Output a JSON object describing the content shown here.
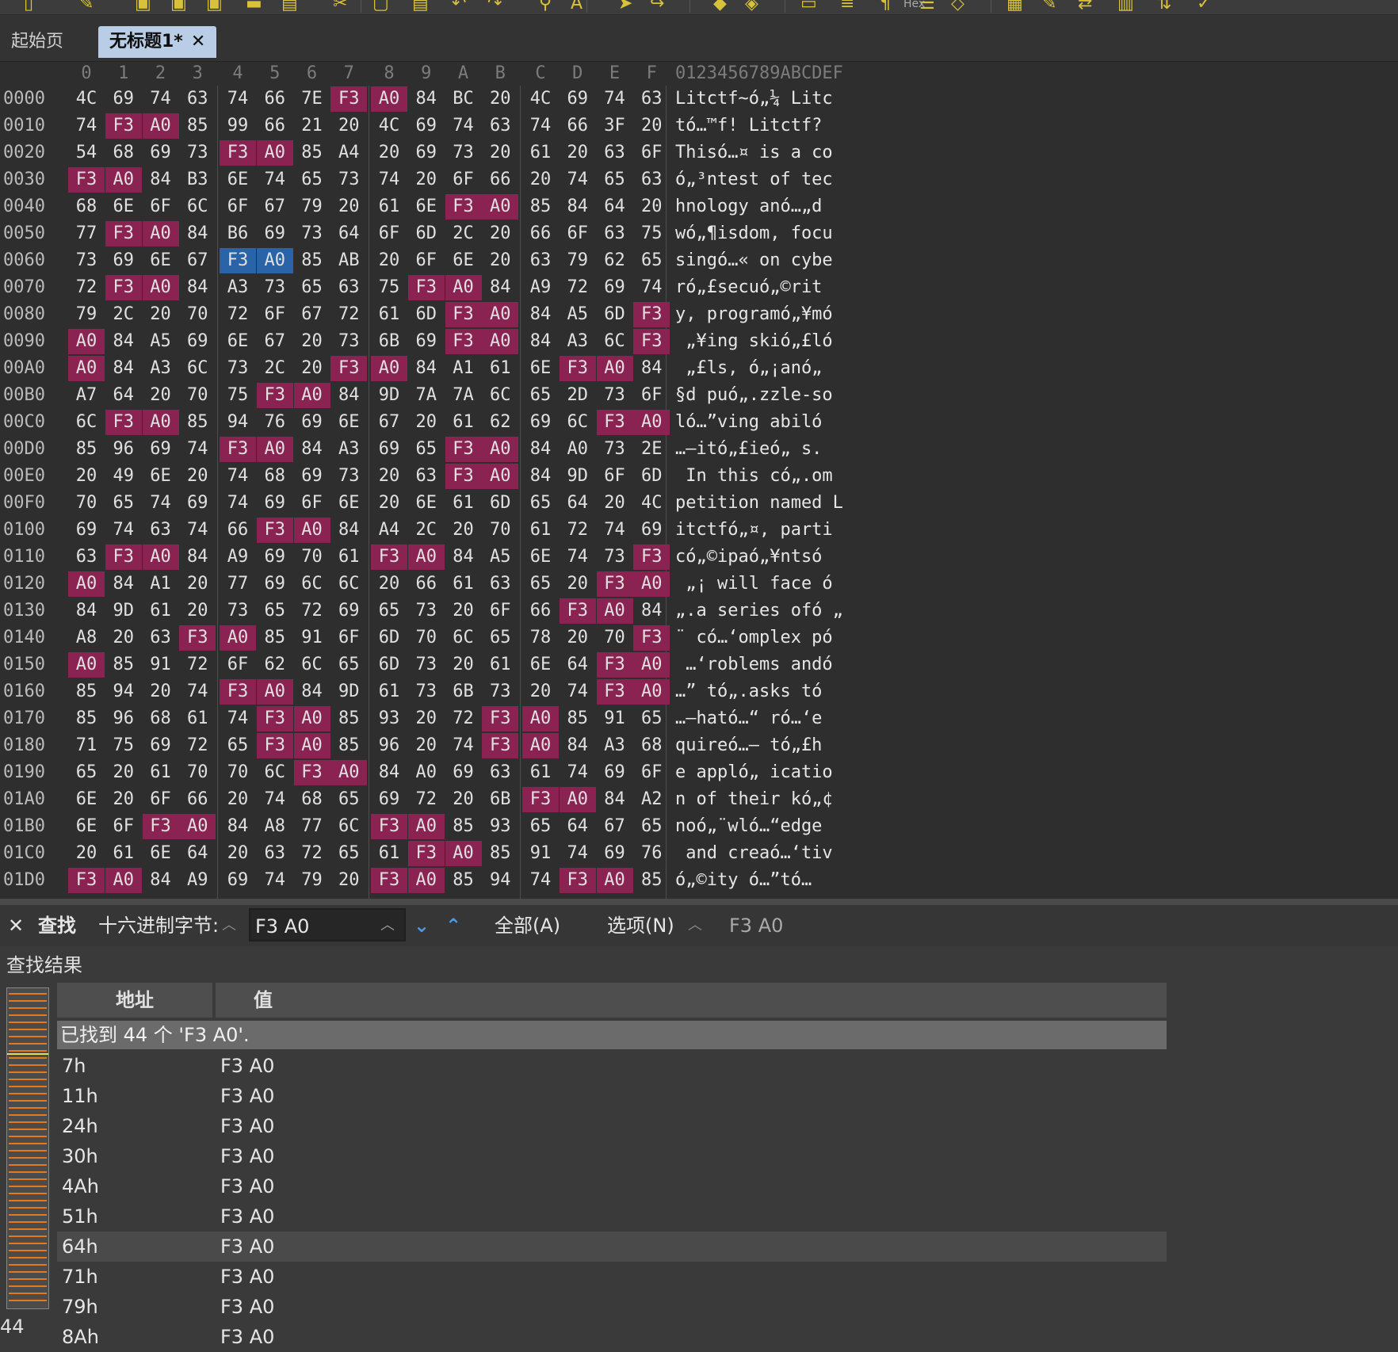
{
  "toolbar": {
    "icons": [
      "new-file",
      "open-folder",
      "save",
      "save-as",
      "save-all",
      "folder",
      "copy-files",
      "cut",
      "copy",
      "paste",
      "undo",
      "redo",
      "find",
      "replace-text",
      "find-next",
      "go-to",
      "bookmark",
      "compare",
      "hex-mode",
      "word-wrap",
      "pilcrow",
      "columns",
      "erase",
      "table",
      "edit",
      "transfer",
      "chart",
      "sort",
      "checklist"
    ],
    "hex_badge": "Hex"
  },
  "tabs": [
    {
      "label": "起始页",
      "active": false
    },
    {
      "label": "无标题1*",
      "active": true,
      "close": "✕"
    }
  ],
  "hex_view": {
    "column_headers": [
      "0",
      "1",
      "2",
      "3",
      "4",
      "5",
      "6",
      "7",
      "8",
      "9",
      "A",
      "B",
      "C",
      "D",
      "E",
      "F"
    ],
    "ascii_header": "0123456789ABCDEF",
    "rows": [
      {
        "addr": "0000",
        "bytes": [
          "4C",
          "69",
          "74",
          "63",
          "74",
          "66",
          "7E",
          "F3",
          "A0",
          "84",
          "BC",
          "20",
          "4C",
          "69",
          "74",
          "63"
        ],
        "ascii": "Litctf~ó„¼ Litc"
      },
      {
        "addr": "0010",
        "bytes": [
          "74",
          "F3",
          "A0",
          "85",
          "99",
          "66",
          "21",
          "20",
          "4C",
          "69",
          "74",
          "63",
          "74",
          "66",
          "3F",
          "20"
        ],
        "ascii": "tó…™f! Litctf? "
      },
      {
        "addr": "0020",
        "bytes": [
          "54",
          "68",
          "69",
          "73",
          "F3",
          "A0",
          "85",
          "A4",
          "20",
          "69",
          "73",
          "20",
          "61",
          "20",
          "63",
          "6F"
        ],
        "ascii": "Thisó…¤ is a co"
      },
      {
        "addr": "0030",
        "bytes": [
          "F3",
          "A0",
          "84",
          "B3",
          "6E",
          "74",
          "65",
          "73",
          "74",
          "20",
          "6F",
          "66",
          "20",
          "74",
          "65",
          "63"
        ],
        "ascii": "ó„³ntest of tec"
      },
      {
        "addr": "0040",
        "bytes": [
          "68",
          "6E",
          "6F",
          "6C",
          "6F",
          "67",
          "79",
          "20",
          "61",
          "6E",
          "F3",
          "A0",
          "85",
          "84",
          "64",
          "20"
        ],
        "ascii": "hnology anó…„d "
      },
      {
        "addr": "0050",
        "bytes": [
          "77",
          "F3",
          "A0",
          "84",
          "B6",
          "69",
          "73",
          "64",
          "6F",
          "6D",
          "2C",
          "20",
          "66",
          "6F",
          "63",
          "75"
        ],
        "ascii": "wó„¶isdom, focu"
      },
      {
        "addr": "0060",
        "bytes": [
          "73",
          "69",
          "6E",
          "67",
          "F3",
          "A0",
          "85",
          "AB",
          "20",
          "6F",
          "6E",
          "20",
          "63",
          "79",
          "62",
          "65"
        ],
        "ascii": "singó…« on cybe"
      },
      {
        "addr": "0070",
        "bytes": [
          "72",
          "F3",
          "A0",
          "84",
          "A3",
          "73",
          "65",
          "63",
          "75",
          "F3",
          "A0",
          "84",
          "A9",
          "72",
          "69",
          "74"
        ],
        "ascii": "ró„£secuó„©rit"
      },
      {
        "addr": "0080",
        "bytes": [
          "79",
          "2C",
          "20",
          "70",
          "72",
          "6F",
          "67",
          "72",
          "61",
          "6D",
          "F3",
          "A0",
          "84",
          "A5",
          "6D",
          "F3"
        ],
        "ascii": "y, programó„¥mó"
      },
      {
        "addr": "0090",
        "bytes": [
          "A0",
          "84",
          "A5",
          "69",
          "6E",
          "67",
          "20",
          "73",
          "6B",
          "69",
          "F3",
          "A0",
          "84",
          "A3",
          "6C",
          "F3"
        ],
        "ascii": " „¥ing skió„£ló"
      },
      {
        "addr": "00A0",
        "bytes": [
          "A0",
          "84",
          "A3",
          "6C",
          "73",
          "2C",
          "20",
          "F3",
          "A0",
          "84",
          "A1",
          "61",
          "6E",
          "F3",
          "A0",
          "84"
        ],
        "ascii": " „£ls, ó„¡anó„"
      },
      {
        "addr": "00B0",
        "bytes": [
          "A7",
          "64",
          "20",
          "70",
          "75",
          "F3",
          "A0",
          "84",
          "9D",
          "7A",
          "7A",
          "6C",
          "65",
          "2D",
          "73",
          "6F"
        ],
        "ascii": "§d puó„.zzle-so"
      },
      {
        "addr": "00C0",
        "bytes": [
          "6C",
          "F3",
          "A0",
          "85",
          "94",
          "76",
          "69",
          "6E",
          "67",
          "20",
          "61",
          "62",
          "69",
          "6C",
          "F3",
          "A0"
        ],
        "ascii": "ló…”ving abiló "
      },
      {
        "addr": "00D0",
        "bytes": [
          "85",
          "96",
          "69",
          "74",
          "F3",
          "A0",
          "84",
          "A3",
          "69",
          "65",
          "F3",
          "A0",
          "84",
          "A0",
          "73",
          "2E"
        ],
        "ascii": "…–itó„£ieó„ s."
      },
      {
        "addr": "00E0",
        "bytes": [
          "20",
          "49",
          "6E",
          "20",
          "74",
          "68",
          "69",
          "73",
          "20",
          "63",
          "F3",
          "A0",
          "84",
          "9D",
          "6F",
          "6D"
        ],
        "ascii": " In this có„.om"
      },
      {
        "addr": "00F0",
        "bytes": [
          "70",
          "65",
          "74",
          "69",
          "74",
          "69",
          "6F",
          "6E",
          "20",
          "6E",
          "61",
          "6D",
          "65",
          "64",
          "20",
          "4C"
        ],
        "ascii": "petition named L"
      },
      {
        "addr": "0100",
        "bytes": [
          "69",
          "74",
          "63",
          "74",
          "66",
          "F3",
          "A0",
          "84",
          "A4",
          "2C",
          "20",
          "70",
          "61",
          "72",
          "74",
          "69"
        ],
        "ascii": "itctfó„¤, parti"
      },
      {
        "addr": "0110",
        "bytes": [
          "63",
          "F3",
          "A0",
          "84",
          "A9",
          "69",
          "70",
          "61",
          "F3",
          "A0",
          "84",
          "A5",
          "6E",
          "74",
          "73",
          "F3"
        ],
        "ascii": "có„©ipaó„¥ntsó"
      },
      {
        "addr": "0120",
        "bytes": [
          "A0",
          "84",
          "A1",
          "20",
          "77",
          "69",
          "6C",
          "6C",
          "20",
          "66",
          "61",
          "63",
          "65",
          "20",
          "F3",
          "A0"
        ],
        "ascii": " „¡ will face ó "
      },
      {
        "addr": "0130",
        "bytes": [
          "84",
          "9D",
          "61",
          "20",
          "73",
          "65",
          "72",
          "69",
          "65",
          "73",
          "20",
          "6F",
          "66",
          "F3",
          "A0",
          "84"
        ],
        "ascii": "„.a series ofó „"
      },
      {
        "addr": "0140",
        "bytes": [
          "A8",
          "20",
          "63",
          "F3",
          "A0",
          "85",
          "91",
          "6F",
          "6D",
          "70",
          "6C",
          "65",
          "78",
          "20",
          "70",
          "F3"
        ],
        "ascii": "¨ có…‘omplex pó"
      },
      {
        "addr": "0150",
        "bytes": [
          "A0",
          "85",
          "91",
          "72",
          "6F",
          "62",
          "6C",
          "65",
          "6D",
          "73",
          "20",
          "61",
          "6E",
          "64",
          "F3",
          "A0"
        ],
        "ascii": " …‘roblems andó "
      },
      {
        "addr": "0160",
        "bytes": [
          "85",
          "94",
          "20",
          "74",
          "F3",
          "A0",
          "84",
          "9D",
          "61",
          "73",
          "6B",
          "73",
          "20",
          "74",
          "F3",
          "A0"
        ],
        "ascii": "…” tó„.asks tó "
      },
      {
        "addr": "0170",
        "bytes": [
          "85",
          "96",
          "68",
          "61",
          "74",
          "F3",
          "A0",
          "85",
          "93",
          "20",
          "72",
          "F3",
          "A0",
          "85",
          "91",
          "65"
        ],
        "ascii": "…–ható…“ ró…‘e"
      },
      {
        "addr": "0180",
        "bytes": [
          "71",
          "75",
          "69",
          "72",
          "65",
          "F3",
          "A0",
          "85",
          "96",
          "20",
          "74",
          "F3",
          "A0",
          "84",
          "A3",
          "68"
        ],
        "ascii": "quireó…– tó„£h"
      },
      {
        "addr": "0190",
        "bytes": [
          "65",
          "20",
          "61",
          "70",
          "70",
          "6C",
          "F3",
          "A0",
          "84",
          "A0",
          "69",
          "63",
          "61",
          "74",
          "69",
          "6F"
        ],
        "ascii": "e appló„ icatio"
      },
      {
        "addr": "01A0",
        "bytes": [
          "6E",
          "20",
          "6F",
          "66",
          "20",
          "74",
          "68",
          "65",
          "69",
          "72",
          "20",
          "6B",
          "F3",
          "A0",
          "84",
          "A2"
        ],
        "ascii": "n of their kó„¢"
      },
      {
        "addr": "01B0",
        "bytes": [
          "6E",
          "6F",
          "F3",
          "A0",
          "84",
          "A8",
          "77",
          "6C",
          "F3",
          "A0",
          "85",
          "93",
          "65",
          "64",
          "67",
          "65"
        ],
        "ascii": "noó„¨wló…“edge"
      },
      {
        "addr": "01C0",
        "bytes": [
          "20",
          "61",
          "6E",
          "64",
          "20",
          "63",
          "72",
          "65",
          "61",
          "F3",
          "A0",
          "85",
          "91",
          "74",
          "69",
          "76"
        ],
        "ascii": " and creaó…‘tiv"
      },
      {
        "addr": "01D0",
        "bytes": [
          "F3",
          "A0",
          "84",
          "A9",
          "69",
          "74",
          "79",
          "20",
          "F3",
          "A0",
          "85",
          "94",
          "74",
          "F3",
          "A0",
          "85"
        ],
        "ascii": "ó„©ity ó…”tó…"
      }
    ]
  },
  "find_bar": {
    "close": "✕",
    "title": "查找",
    "mode_label": "十六进制字节:",
    "input_value": "F3 A0",
    "all_label": "全部(A)",
    "options_label": "选项(N)",
    "recent_value": "F3 A0"
  },
  "results": {
    "title": "查找结果",
    "col_address": "地址",
    "col_value": "值",
    "summary": "已找到 44 个 'F3 A0'.",
    "count_label": "44",
    "rows": [
      {
        "address": "7h",
        "value": "F3 A0"
      },
      {
        "address": "11h",
        "value": "F3 A0"
      },
      {
        "address": "24h",
        "value": "F3 A0"
      },
      {
        "address": "30h",
        "value": "F3 A0"
      },
      {
        "address": "4Ah",
        "value": "F3 A0"
      },
      {
        "address": "51h",
        "value": "F3 A0"
      },
      {
        "address": "64h",
        "value": "F3 A0"
      },
      {
        "address": "71h",
        "value": "F3 A0"
      },
      {
        "address": "79h",
        "value": "F3 A0"
      },
      {
        "address": "8Ah",
        "value": "F3 A0"
      }
    ]
  },
  "colors": {
    "match_highlight": "#8a2352",
    "cursor_highlight": "#2a63a8",
    "active_tab": "#b9cde6",
    "overview_marks": "#e07a1d",
    "search_arrows": "#4c9be8"
  }
}
